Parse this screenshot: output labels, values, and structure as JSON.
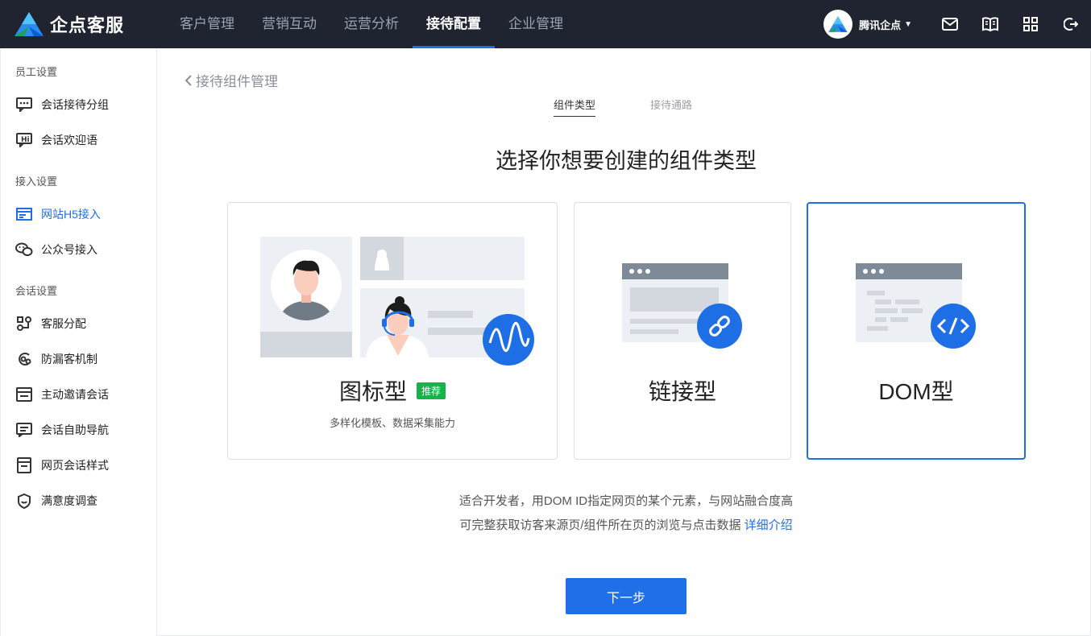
{
  "brand": {
    "name": "企点客服"
  },
  "nav": [
    {
      "label": "客户管理"
    },
    {
      "label": "营销互动"
    },
    {
      "label": "运营分析"
    },
    {
      "label": "接待配置"
    },
    {
      "label": "企业管理"
    }
  ],
  "nav_active_index": 3,
  "account": {
    "name": "腾讯企点"
  },
  "top_icons": [
    "mail-icon",
    "book-icon",
    "grid-icon",
    "logout-icon"
  ],
  "sidebar": {
    "sections": [
      {
        "title": "员工设置",
        "items": [
          {
            "label": "会话接待分组",
            "icon": "chat-group-icon"
          },
          {
            "label": "会话欢迎语",
            "icon": "hi-message-icon"
          }
        ]
      },
      {
        "title": "接入设置",
        "items": [
          {
            "label": "网站H5接入",
            "icon": "website-icon"
          },
          {
            "label": "公众号接入",
            "icon": "wechat-icon"
          }
        ]
      },
      {
        "title": "会话设置",
        "items": [
          {
            "label": "客服分配",
            "icon": "assign-icon"
          },
          {
            "label": "防漏客机制",
            "icon": "guard-icon"
          },
          {
            "label": "主动邀请会话",
            "icon": "invite-icon"
          },
          {
            "label": "会话自助导航",
            "icon": "navigation-icon"
          },
          {
            "label": "网页会话样式",
            "icon": "style-icon"
          },
          {
            "label": "满意度调查",
            "icon": "survey-icon"
          }
        ]
      }
    ],
    "active_item": "网站H5接入"
  },
  "main": {
    "back_label": "接待组件管理",
    "steps": [
      {
        "label": "组件类型"
      },
      {
        "label": "接待通路"
      }
    ],
    "title": "选择你想要创建的组件类型",
    "cards": [
      {
        "title": "图标型",
        "badge": "推荐",
        "subtitle": "多样化模板、数据采集能力"
      },
      {
        "title": "链接型"
      },
      {
        "title": "DOM型"
      }
    ],
    "selected_card": "DOM型",
    "description_line1": "适合开发者，用DOM ID指定网页的某个元素，与网站融合度高",
    "description_line2": "可完整获取访客来源页/组件所在页的浏览与点击数据",
    "detail_link": "详细介绍",
    "next_button": "下一步"
  },
  "colors": {
    "topbar": "#1f2430",
    "accent": "#1e6fe6",
    "badge": "#16b34a"
  }
}
